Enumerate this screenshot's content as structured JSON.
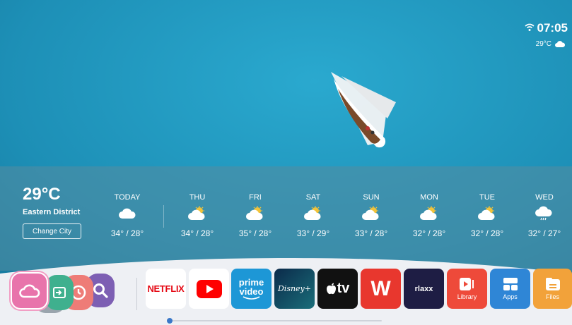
{
  "status": {
    "time": "07:05",
    "temp": "29°C",
    "wifi_icon": "wifi-icon",
    "weather_icon": "cloud-icon"
  },
  "weather": {
    "current_temp": "29°C",
    "district": "Eastern District",
    "change_city": "Change City",
    "days": [
      {
        "label": "TODAY",
        "range": "34° / 28°",
        "icon": "cloud"
      },
      {
        "label": "THU",
        "range": "34° / 28°",
        "icon": "partly-sunny"
      },
      {
        "label": "FRI",
        "range": "35° / 28°",
        "icon": "partly-sunny"
      },
      {
        "label": "SAT",
        "range": "33° / 29°",
        "icon": "partly-sunny"
      },
      {
        "label": "SUN",
        "range": "33° / 28°",
        "icon": "partly-sunny"
      },
      {
        "label": "MON",
        "range": "32° / 28°",
        "icon": "partly-sunny"
      },
      {
        "label": "TUE",
        "range": "32° / 28°",
        "icon": "partly-sunny"
      },
      {
        "label": "WED",
        "range": "32° / 27°",
        "icon": "rain-cloud"
      }
    ]
  },
  "dock": {
    "quick_icons": [
      "cloud-icon",
      "input-source-icon",
      "clock-icon",
      "search-icon"
    ],
    "apps": {
      "netflix": "NETFLIX",
      "youtube": "YouTube",
      "prime_line1": "prime",
      "prime_line2": "video",
      "disney": "Disney+",
      "appletv": "tv",
      "wps": "W",
      "rlaxx": "rlaxx",
      "library": "Library",
      "apps": "Apps",
      "files": "Files"
    },
    "accent_color": "#3a78c8"
  }
}
